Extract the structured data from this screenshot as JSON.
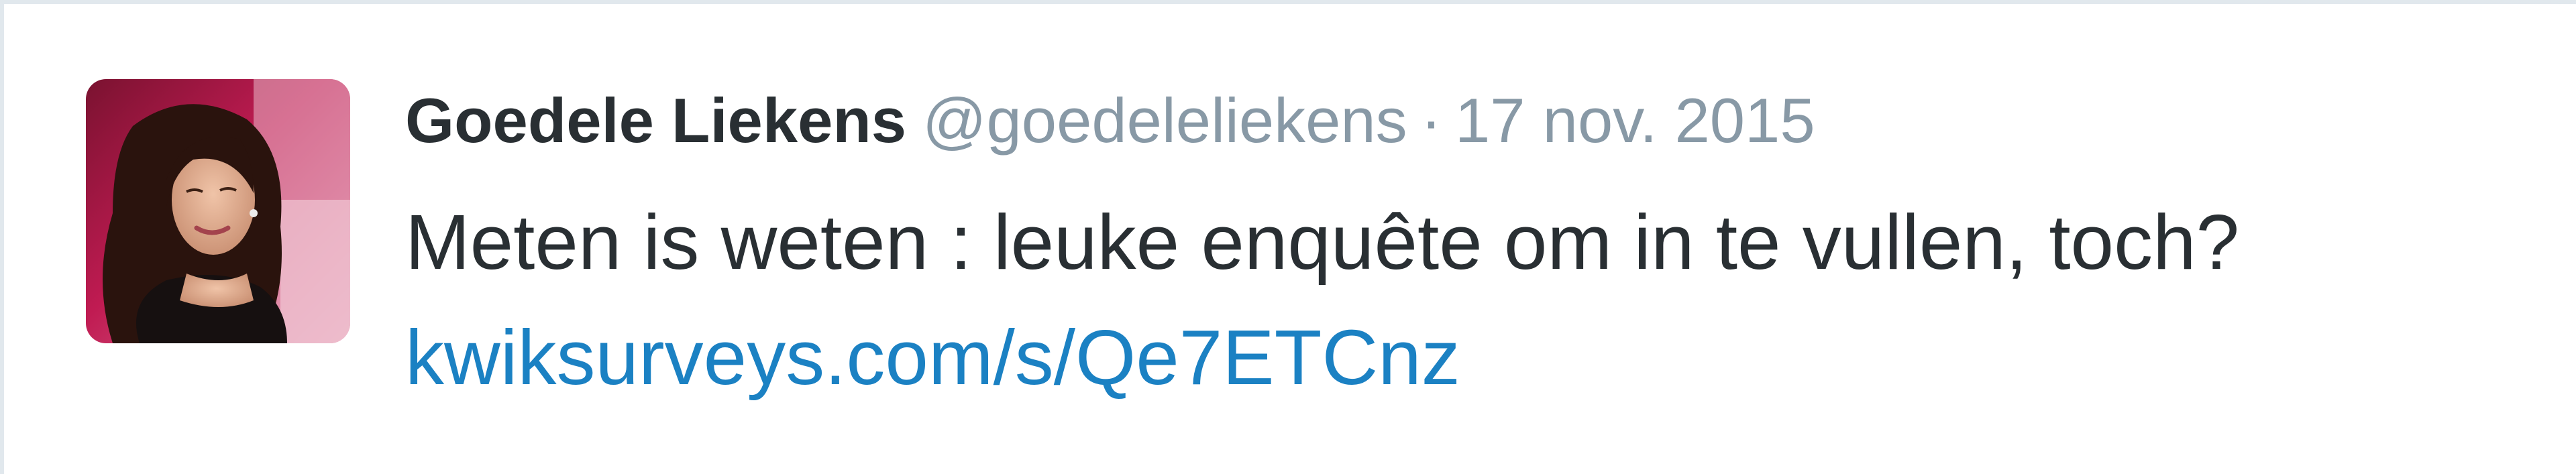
{
  "tweet": {
    "author_name": "Goedele Liekens",
    "author_handle": "@goedeleliekens",
    "separator": "·",
    "timestamp": "17 nov. 2015",
    "text": "Meten is weten : leuke enquête om in te vullen, toch?",
    "link_text": "kwiksurveys.com/s/Qe7ETCnz"
  },
  "colors": {
    "name": "#292f33",
    "meta": "#8899a6",
    "link": "#1b81c3",
    "border": "#e1e8ed"
  }
}
